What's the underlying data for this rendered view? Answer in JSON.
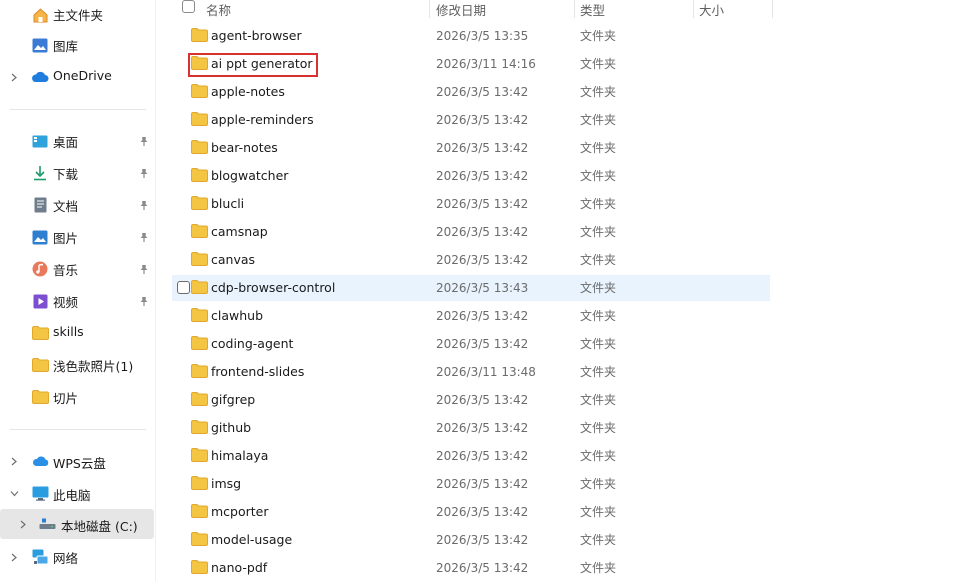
{
  "sidebar": {
    "quick_top": [
      {
        "label": "主文件夹",
        "icon": "home-icon"
      },
      {
        "label": "图库",
        "icon": "gallery-icon"
      }
    ],
    "onedrive": {
      "label": "OneDrive",
      "icon": "cloud-icon"
    },
    "pinned": [
      {
        "label": "桌面",
        "icon": "desktop-icon"
      },
      {
        "label": "下载",
        "icon": "download-icon"
      },
      {
        "label": "文档",
        "icon": "document-icon"
      },
      {
        "label": "图片",
        "icon": "picture-icon"
      },
      {
        "label": "音乐",
        "icon": "music-icon"
      },
      {
        "label": "视频",
        "icon": "video-icon"
      }
    ],
    "folders": [
      {
        "label": "skills",
        "icon": "folder-icon"
      },
      {
        "label": "浅色款照片(1)",
        "icon": "folder-icon"
      },
      {
        "label": "切片",
        "icon": "folder-icon"
      }
    ],
    "wps": {
      "label": "WPS云盘",
      "icon": "wps-cloud-icon"
    },
    "this_pc": {
      "label": "此电脑",
      "icon": "computer-icon"
    },
    "local_disk": {
      "label": "本地磁盘 (C:)",
      "icon": "drive-icon"
    },
    "network": {
      "label": "网络",
      "icon": "network-icon"
    }
  },
  "columns": {
    "name": "名称",
    "date": "修改日期",
    "type": "类型",
    "size": "大小"
  },
  "files": [
    {
      "name": "agent-browser",
      "date": "2026/3/5 13:35",
      "type": "文件夹"
    },
    {
      "name": "ai ppt generator",
      "date": "2026/3/11 14:16",
      "type": "文件夹"
    },
    {
      "name": "apple-notes",
      "date": "2026/3/5 13:42",
      "type": "文件夹"
    },
    {
      "name": "apple-reminders",
      "date": "2026/3/5 13:42",
      "type": "文件夹"
    },
    {
      "name": "bear-notes",
      "date": "2026/3/5 13:42",
      "type": "文件夹"
    },
    {
      "name": "blogwatcher",
      "date": "2026/3/5 13:42",
      "type": "文件夹"
    },
    {
      "name": "blucli",
      "date": "2026/3/5 13:42",
      "type": "文件夹"
    },
    {
      "name": "camsnap",
      "date": "2026/3/5 13:42",
      "type": "文件夹"
    },
    {
      "name": "canvas",
      "date": "2026/3/5 13:42",
      "type": "文件夹"
    },
    {
      "name": "cdp-browser-control",
      "date": "2026/3/5 13:43",
      "type": "文件夹"
    },
    {
      "name": "clawhub",
      "date": "2026/3/5 13:42",
      "type": "文件夹"
    },
    {
      "name": "coding-agent",
      "date": "2026/3/5 13:42",
      "type": "文件夹"
    },
    {
      "name": "frontend-slides",
      "date": "2026/3/11 13:48",
      "type": "文件夹"
    },
    {
      "name": "gifgrep",
      "date": "2026/3/5 13:42",
      "type": "文件夹"
    },
    {
      "name": "github",
      "date": "2026/3/5 13:42",
      "type": "文件夹"
    },
    {
      "name": "himalaya",
      "date": "2026/3/5 13:42",
      "type": "文件夹"
    },
    {
      "name": "imsg",
      "date": "2026/3/5 13:42",
      "type": "文件夹"
    },
    {
      "name": "mcporter",
      "date": "2026/3/5 13:42",
      "type": "文件夹"
    },
    {
      "name": "model-usage",
      "date": "2026/3/5 13:42",
      "type": "文件夹"
    },
    {
      "name": "nano-pdf",
      "date": "2026/3/5 13:42",
      "type": "文件夹"
    }
  ],
  "hover_row": "cdp-browser-control",
  "highlighted_row": "ai ppt generator",
  "colors": {
    "folder": "#f4c542",
    "folder_dark": "#e0a92c",
    "accent_red": "#d93030",
    "hover_bg": "#e8f3fd",
    "selected_bg": "#e6e6e6"
  }
}
